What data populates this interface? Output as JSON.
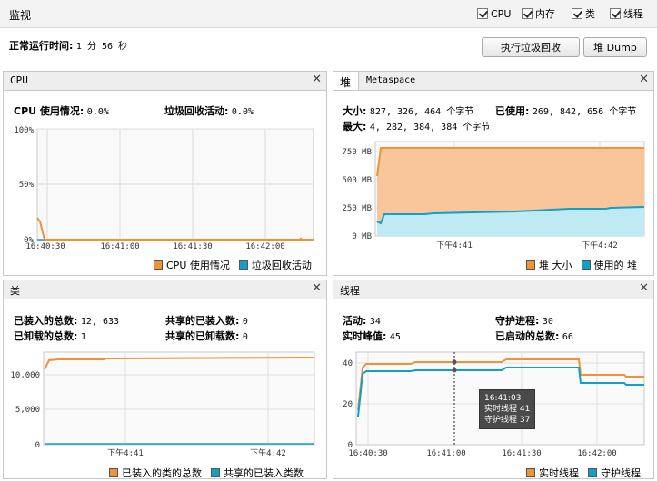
{
  "topbar": {
    "title": "监视",
    "checkboxes": [
      {
        "label": "CPU",
        "checked": true
      },
      {
        "label": "内存",
        "checked": true
      },
      {
        "label": "类",
        "checked": true
      },
      {
        "label": "线程",
        "checked": true
      }
    ]
  },
  "uptime": {
    "label": "正常运行时间:",
    "value": "1 分 56 秒"
  },
  "buttons": {
    "gc": "执行垃圾回收",
    "heap_dump": "堆 Dump"
  },
  "colors": {
    "orange": "#f0923a",
    "orange_fill": "#f8c69a",
    "teal": "#12a0c8",
    "teal_fill": "#bfe9f3"
  },
  "cpu": {
    "title": "CPU",
    "usage_label": "CPU 使用情况:",
    "usage_value": "0.0%",
    "gc_label": "垃圾回收活动:",
    "gc_value": "0.0%",
    "y_ticks": [
      "100%",
      "50%",
      "0%"
    ],
    "x_ticks": [
      "16:40:30",
      "16:41:00",
      "16:41:30",
      "16:42:00"
    ],
    "legend": [
      "CPU 使用情况",
      "垃圾回收活动"
    ]
  },
  "heap": {
    "tab_heap": "堆",
    "tab_meta": "Metaspace",
    "size_label": "大小:",
    "size_value": "827, 326, 464 个字节",
    "used_label": "已使用:",
    "used_value": "269, 842, 656 个字节",
    "max_label": "最大:",
    "max_value": "4, 282, 384, 384 个字节",
    "y_ticks": [
      "750 MB",
      "500 MB",
      "250 MB",
      "0 MB"
    ],
    "x_ticks": [
      "下午4:41",
      "下午4:42"
    ],
    "legend": [
      "堆 大小",
      "使用的 堆"
    ]
  },
  "classes": {
    "title": "类",
    "loaded_label": "已装入的总数:",
    "loaded_value": "12, 633",
    "unloaded_label": "已卸载的总数:",
    "unloaded_value": "1",
    "shared_loaded_label": "共享的已装入数:",
    "shared_loaded_value": "0",
    "shared_unloaded_label": "共享的已卸载数:",
    "shared_unloaded_value": "0",
    "y_ticks": [
      "10,000",
      "5,000",
      "0"
    ],
    "x_ticks": [
      "下午4:41",
      "下午4:42"
    ],
    "legend": [
      "已装入的类的总数",
      "共享的已装入类数"
    ]
  },
  "threads": {
    "title": "线程",
    "live_label": "活动:",
    "live_value": "34",
    "daemon_label": "守护进程:",
    "daemon_value": "30",
    "peak_label": "实时峰值:",
    "peak_value": "45",
    "started_label": "已启动的总数:",
    "started_value": "66",
    "y_ticks": [
      "40",
      "20",
      "0"
    ],
    "x_ticks": [
      "16:40:30",
      "16:41:00",
      "16:41:30",
      "16:42:00"
    ],
    "tooltip": {
      "time": "16:41:03",
      "live_label": "实时线程",
      "live_value": "41",
      "daemon_label": "守护线程",
      "daemon_value": "37"
    },
    "legend": [
      "实时线程",
      "守护线程"
    ]
  },
  "chart_data": [
    {
      "type": "line",
      "name": "cpu",
      "x": [
        "16:40:20",
        "16:40:22",
        "16:40:25",
        "16:42:20"
      ],
      "series": [
        {
          "name": "CPU 使用情况",
          "values": [
            20,
            15,
            0,
            0
          ]
        },
        {
          "name": "垃圾回收活动",
          "values": [
            0,
            0,
            0,
            0
          ]
        }
      ],
      "ylim": [
        0,
        100
      ]
    },
    {
      "type": "area",
      "name": "heap",
      "x_ticks": [
        "下午4:41",
        "下午4:42"
      ],
      "series": [
        {
          "name": "堆 大小",
          "values_mb": [
            560,
            770,
            789,
            789,
            789
          ]
        },
        {
          "name": "使用的 堆",
          "values_mb": [
            130,
            110,
            190,
            225,
            257
          ]
        }
      ],
      "ylim_mb": [
        0,
        850
      ]
    },
    {
      "type": "line",
      "name": "classes",
      "series": [
        {
          "name": "已装入的类的总数",
          "values": [
            11000,
            12100,
            12300,
            12600,
            12633
          ]
        },
        {
          "name": "共享的已装入类数",
          "values": [
            0,
            0,
            0,
            0,
            0
          ]
        }
      ],
      "ylim": [
        0,
        14000
      ]
    },
    {
      "type": "line",
      "name": "threads",
      "series": [
        {
          "name": "实时线程",
          "values": [
            17,
            40,
            39,
            41,
            43,
            35,
            33
          ]
        },
        {
          "name": "守护线程",
          "values": [
            14,
            36,
            36,
            37,
            39,
            30,
            29
          ]
        }
      ],
      "ylim": [
        0,
        45
      ]
    }
  ]
}
